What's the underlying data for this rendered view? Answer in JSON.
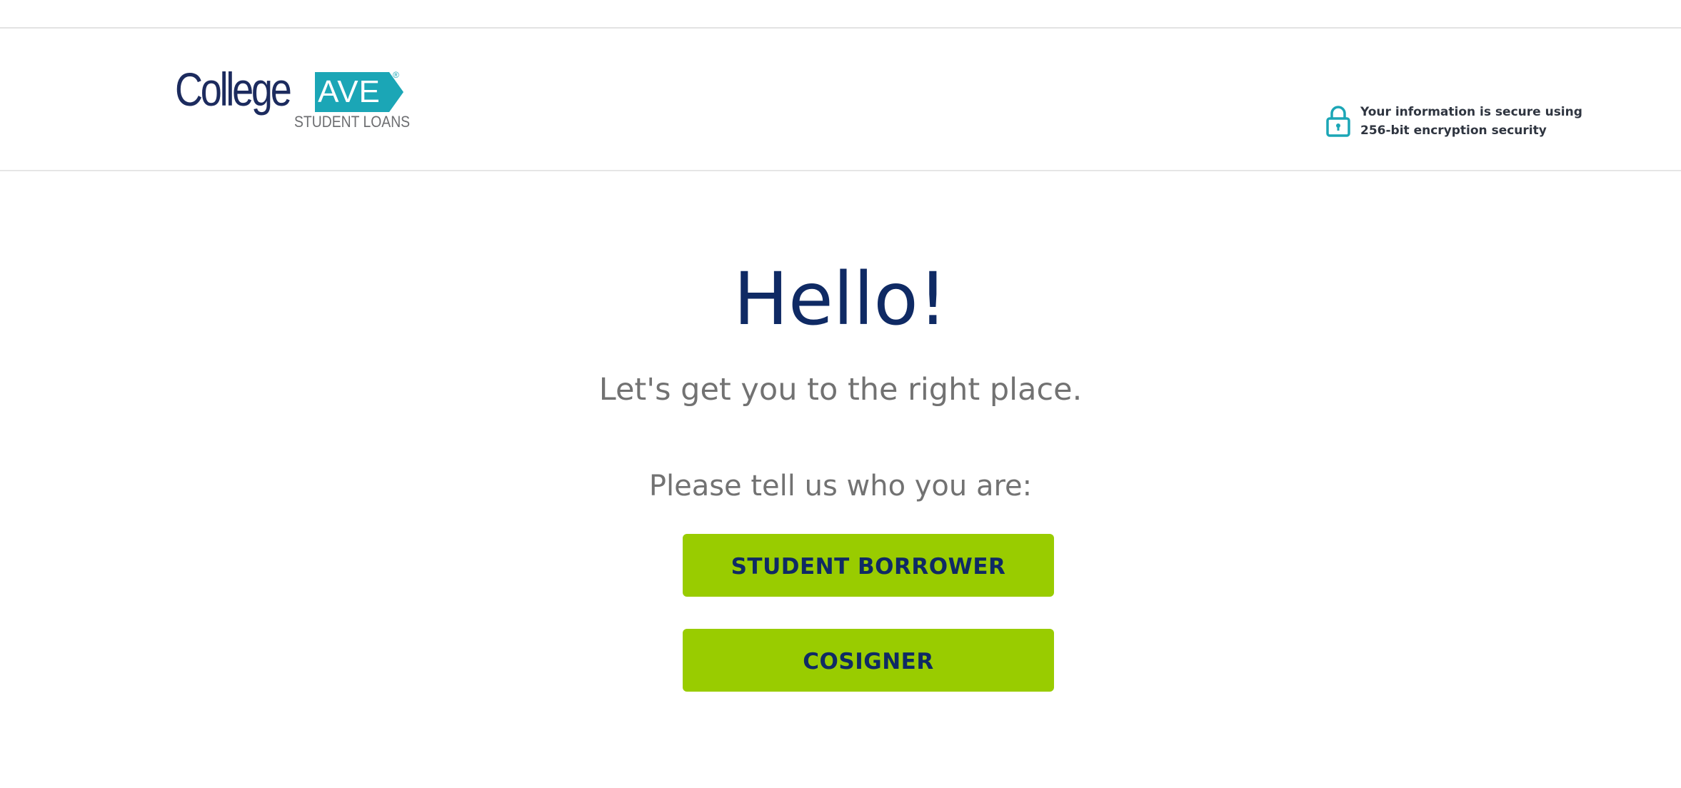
{
  "header": {
    "logo": {
      "brand_name": "College",
      "tag_text": "AVE",
      "registered_mark": "®",
      "subtitle": "STUDENT LOANS"
    },
    "security": {
      "icon": "lock-icon",
      "line1": "Your information is secure using",
      "line2": "256-bit encryption security"
    }
  },
  "main": {
    "greeting": "Hello!",
    "subtitle": "Let's get you to the right place.",
    "prompt": "Please tell us who you are:",
    "buttons": {
      "student_borrower": "STUDENT BORROWER",
      "cosigner": "COSIGNER"
    }
  },
  "colors": {
    "brand_navy": "#0f2a64",
    "brand_teal": "#1ba6b6",
    "button_green": "#99cc00",
    "text_gray": "#727272"
  }
}
